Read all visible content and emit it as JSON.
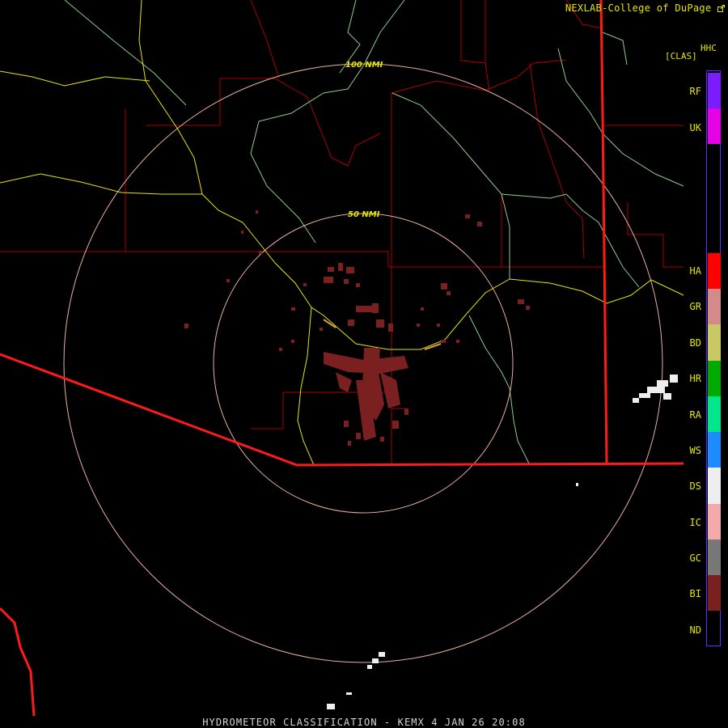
{
  "header": {
    "credit": "NEXLAB-College of DuPage",
    "credit_icon": "external-link-icon"
  },
  "product": {
    "code": "HHC",
    "class": "[CLAS]"
  },
  "rings": [
    {
      "label": "50 NMI"
    },
    {
      "label": "100 NMI"
    }
  ],
  "legend": [
    {
      "code": "RF",
      "color": "#7a1cff"
    },
    {
      "code": "UK",
      "color": "#e600e6"
    },
    {
      "code": "HA",
      "color": "#ff0000"
    },
    {
      "code": "GR",
      "color": "#d38a8a"
    },
    {
      "code": "BD",
      "color": "#c8c864"
    },
    {
      "code": "HR",
      "color": "#00aa00"
    },
    {
      "code": "RA",
      "color": "#00e68c"
    },
    {
      "code": "WS",
      "color": "#1e8cff"
    },
    {
      "code": "DS",
      "color": "#eeeeee"
    },
    {
      "code": "IC",
      "color": "#f2aaaa"
    },
    {
      "code": "GC",
      "color": "#787878"
    },
    {
      "code": "BI",
      "color": "#7a2020"
    },
    {
      "code": "ND",
      "color": "#000000"
    }
  ],
  "colors": {
    "state_border": "#ff1a1a",
    "county_border": "#aa0000",
    "highway": "#e6e600",
    "river": "#8ccc8c",
    "range_ring": "#e8b0a0",
    "biological_echo": "#7a2020",
    "dry_snow_echo": "#eeeeee"
  },
  "footer": {
    "title": "HYDROMETEOR CLASSIFICATION - KEMX 4 JAN 26 20:08"
  }
}
